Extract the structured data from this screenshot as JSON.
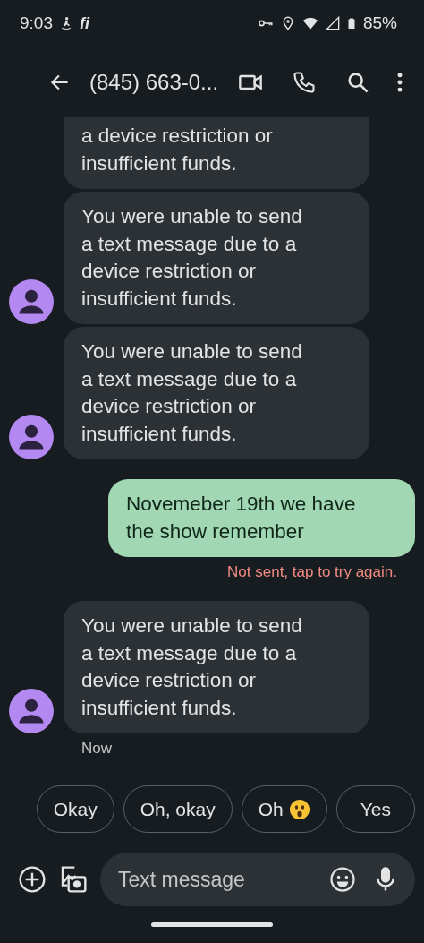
{
  "status_bar": {
    "time": "9:03",
    "carrier": "fi",
    "battery": "85%"
  },
  "app_bar": {
    "title": "(845) 663-0..."
  },
  "messages": [
    {
      "kind": "received",
      "text": "a device restriction or insufficient funds.",
      "clipped": true,
      "avatar": false
    },
    {
      "kind": "received",
      "text": "You were unable to send a text message due to a device restriction or insufficient funds.",
      "clipped": false,
      "avatar": true
    },
    {
      "kind": "received",
      "text": "You were unable to send a text message due to a device restriction or insufficient funds.",
      "clipped": false,
      "avatar": true
    },
    {
      "kind": "sent",
      "text": "Novemeber 19th we have the show remember",
      "clipped": false,
      "status": "Not sent, tap to try again."
    },
    {
      "kind": "received",
      "text": "You were unable to send a text message due to a device restriction or insufficient funds.",
      "clipped": false,
      "avatar": true,
      "time": "Now"
    }
  ],
  "suggestions": [
    {
      "label": "Okay",
      "kind": "text"
    },
    {
      "label": "Oh, okay",
      "kind": "text"
    },
    {
      "label": "Oh",
      "kind": "emoji"
    },
    {
      "label": "Yes",
      "kind": "text"
    }
  ],
  "composer": {
    "placeholder": "Text message"
  }
}
